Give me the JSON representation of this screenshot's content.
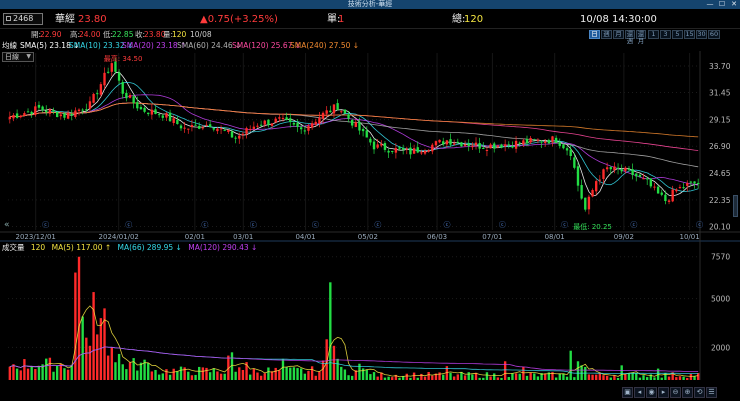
{
  "window": {
    "title": "技術分析-華經",
    "controls": [
      "—",
      "☐",
      "✕"
    ]
  },
  "quote": {
    "code": "2468",
    "name": "華經",
    "price": "23.80",
    "change": "▲0.75(+3.25%)",
    "single_label": "單:",
    "single_value": "1",
    "total_label": "總:",
    "total_value": "120",
    "datetime": "10/08 14:30:00"
  },
  "ohlc": {
    "open_label": "開:",
    "open": "22.90",
    "high_label": "高:",
    "high": "24.00",
    "low_label": "低:",
    "low": "22.85",
    "close_label": "收:",
    "close": "23.80",
    "vol_label": "量:",
    "vol": "120",
    "date": "10/08"
  },
  "timeframes": [
    "日",
    "週",
    "月",
    "還週",
    "還月",
    "1",
    "3",
    "5",
    "15",
    "30",
    "60"
  ],
  "timeframe_active": 0,
  "ma_header": {
    "prefix": "均線",
    "items": [
      {
        "text": "SMA(5) 23.18 ↓",
        "color": "#ffffff"
      },
      {
        "text": "SMA(10) 23.32 ↓",
        "color": "#35d8e8"
      },
      {
        "text": "SMA(20) 23.18 ↑",
        "color": "#c040f0"
      },
      {
        "text": "SMA(60) 24.46 ↓",
        "color": "#b0b0b0"
      },
      {
        "text": "SMA(120) 25.67 ↓",
        "color": "#ff4aa0"
      },
      {
        "text": "SMA(240) 27.50 ↓",
        "color": "#f08a30"
      }
    ]
  },
  "period_select": "日線",
  "annotations": {
    "high": "最高: 34.50",
    "low": "最低: 20.25"
  },
  "volume_header": {
    "prefix": "成交量",
    "value": "120",
    "items": [
      {
        "text": "MA(5) 117.00 ↑",
        "color": "#f0e040"
      },
      {
        "text": "MA(66) 289.95 ↓",
        "color": "#35d8e8"
      },
      {
        "text": "MA(120) 290.43 ↓",
        "color": "#c040f0"
      }
    ]
  },
  "chart_data": {
    "type": "candlestick",
    "price_axis": {
      "ticks": [
        "33.70",
        "31.45",
        "29.15",
        "26.90",
        "24.65",
        "22.35",
        "20.10"
      ],
      "range": [
        19.8,
        34.8
      ]
    },
    "volume_axis": {
      "ticks": [
        "7570",
        "5000",
        "2000"
      ],
      "range": [
        0,
        7800
      ]
    },
    "date_ticks": [
      "2023/12/01",
      "2024/01/02",
      "02/01",
      "03/01",
      "04/01",
      "05/02",
      "06/03",
      "07/01",
      "08/01",
      "09/02",
      "10/01"
    ],
    "bars": 190,
    "anchors": [
      [
        0,
        29.4
      ],
      [
        8,
        30.1
      ],
      [
        15,
        29.5
      ],
      [
        22,
        30.4
      ],
      [
        26,
        32.8
      ],
      [
        28,
        34.0
      ],
      [
        31,
        31.5
      ],
      [
        36,
        30.0
      ],
      [
        42,
        29.6
      ],
      [
        48,
        28.4
      ],
      [
        55,
        28.8
      ],
      [
        62,
        27.6
      ],
      [
        68,
        28.8
      ],
      [
        74,
        29.1
      ],
      [
        80,
        28.3
      ],
      [
        86,
        29.6
      ],
      [
        90,
        30.3
      ],
      [
        95,
        28.6
      ],
      [
        100,
        26.9
      ],
      [
        110,
        26.4
      ],
      [
        120,
        27.4
      ],
      [
        130,
        26.9
      ],
      [
        140,
        27.2
      ],
      [
        150,
        27.5
      ],
      [
        154,
        26.4
      ],
      [
        156,
        23.6
      ],
      [
        158,
        21.5
      ],
      [
        161,
        24.0
      ],
      [
        164,
        25.0
      ],
      [
        170,
        24.7
      ],
      [
        175,
        23.8
      ],
      [
        178,
        22.8
      ],
      [
        180,
        22.3
      ],
      [
        183,
        23.2
      ],
      [
        186,
        23.6
      ],
      [
        189,
        23.8
      ]
    ],
    "volume_spikes": [
      [
        18,
        6600
      ],
      [
        19,
        7570
      ],
      [
        20,
        3900
      ],
      [
        21,
        2600
      ],
      [
        22,
        2100
      ],
      [
        23,
        5400
      ],
      [
        24,
        2800
      ],
      [
        25,
        3800
      ],
      [
        26,
        4400
      ],
      [
        27,
        1500
      ],
      [
        28,
        2000
      ],
      [
        30,
        1600
      ],
      [
        60,
        1500
      ],
      [
        61,
        1700
      ],
      [
        65,
        1100
      ],
      [
        75,
        1300
      ],
      [
        86,
        1200
      ],
      [
        87,
        2500
      ],
      [
        88,
        6000
      ],
      [
        89,
        2100
      ],
      [
        90,
        1300
      ],
      [
        96,
        1000
      ],
      [
        120,
        850
      ],
      [
        136,
        1150
      ],
      [
        141,
        800
      ],
      [
        154,
        1800
      ],
      [
        156,
        1150
      ],
      [
        157,
        900
      ],
      [
        158,
        800
      ],
      [
        168,
        900
      ],
      [
        178,
        700
      ]
    ]
  },
  "markers": {
    "row_icons": [
      "ⓒ",
      "ⓒ",
      "ⓒ",
      "ⓒ",
      "ⓒ",
      "ⓒ",
      "ⓒ",
      "ⓒ",
      "ⓒ",
      "ⓒ",
      "ⓒ"
    ],
    "nav_arrow": "«"
  },
  "toolbar": [
    "▣",
    "◂",
    "◉",
    "▸",
    "⊖",
    "⊕",
    "⟲",
    "☰"
  ]
}
